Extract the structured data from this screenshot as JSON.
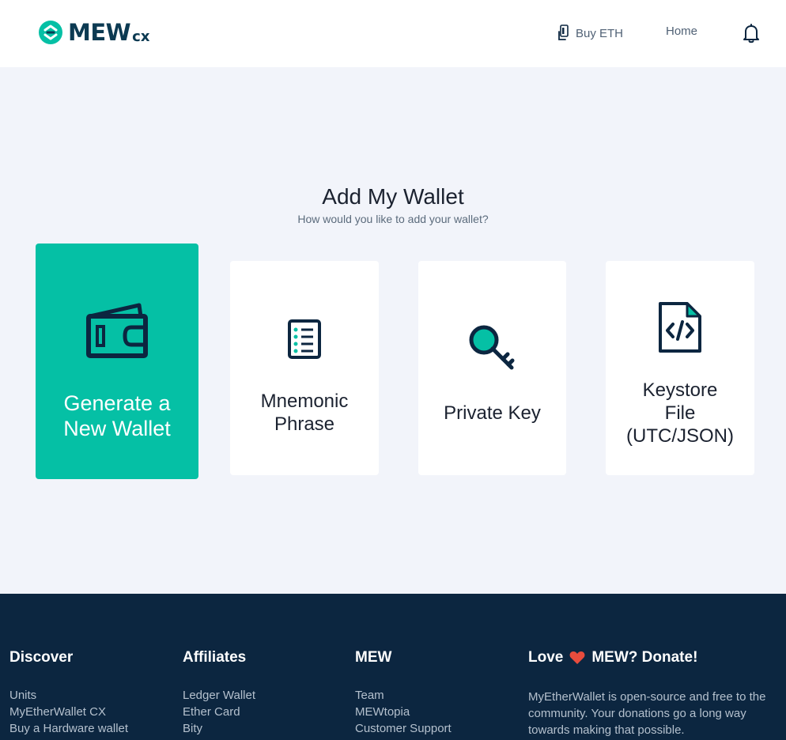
{
  "header": {
    "logo_text": "MEW",
    "logo_suffix": "cx",
    "buy_eth": "Buy ETH",
    "home": "Home"
  },
  "main": {
    "title": "Add My Wallet",
    "subtitle": "How would you like to add your wallet?",
    "options": [
      {
        "line1": "Generate a",
        "line2": "New Wallet",
        "icon": "wallet-icon"
      },
      {
        "line1": "Mnemonic",
        "line2": "Phrase",
        "icon": "mnemonic-list-icon"
      },
      {
        "line1": "Private Key",
        "icon": "key-icon"
      },
      {
        "line1": "Keystore",
        "line2": "File",
        "line3": "(UTC/JSON)",
        "icon": "code-file-icon"
      }
    ]
  },
  "footer": {
    "discover": {
      "heading": "Discover",
      "links": [
        "Units",
        "MyEtherWallet CX",
        "Buy a Hardware wallet"
      ]
    },
    "affiliates": {
      "heading": "Affiliates",
      "links": [
        "Ledger Wallet",
        "Ether Card",
        "Bity"
      ]
    },
    "mew": {
      "heading": "MEW",
      "links": [
        "Team",
        "MEWtopia",
        "Customer Support"
      ]
    },
    "donate": {
      "heading_before": "Love",
      "heading_after": "MEW? Donate!",
      "description": "MyEtherWallet is open-source and free to the community. Your donations go a long way towards making that possible."
    }
  },
  "colors": {
    "accent": "#05c0a5",
    "navy": "#0c2640",
    "background": "#f2f4fa",
    "heart": "#e84c3d"
  }
}
